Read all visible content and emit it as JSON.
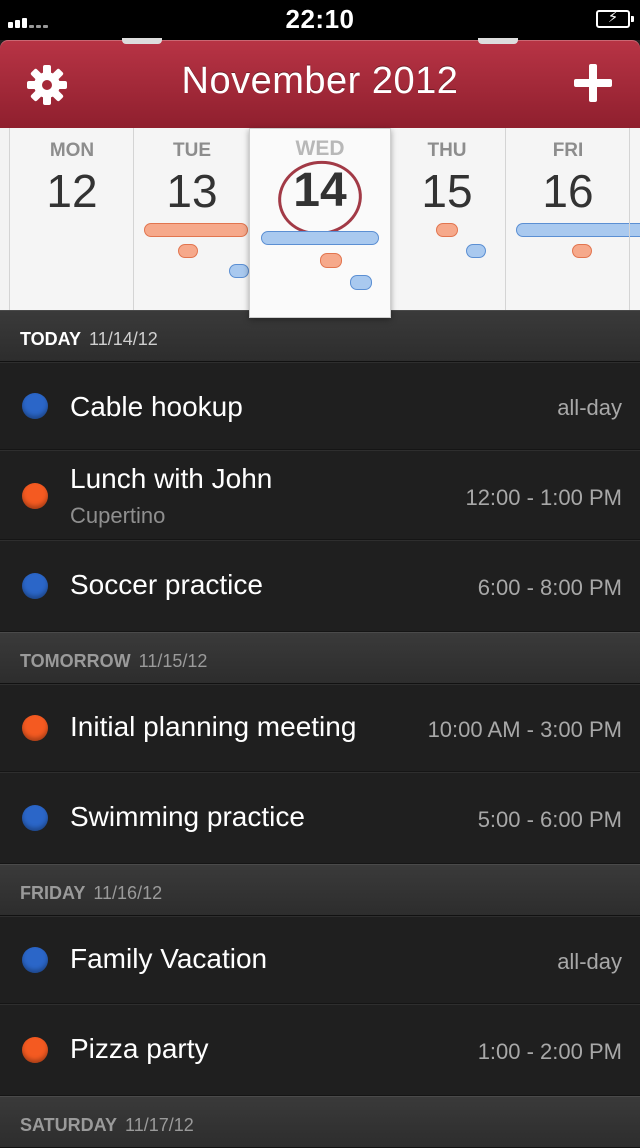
{
  "status": {
    "time": "22:10"
  },
  "header": {
    "title": "November 2012"
  },
  "colors": {
    "orange": "#f45a21",
    "blue": "#2b66c8",
    "header": "#a52838"
  },
  "week": [
    {
      "name": "",
      "num": ""
    },
    {
      "name": "MON",
      "num": "12"
    },
    {
      "name": "TUE",
      "num": "13"
    },
    {
      "name": "WED",
      "num": "14"
    },
    {
      "name": "THU",
      "num": "15"
    },
    {
      "name": "FRI",
      "num": "16"
    }
  ],
  "sections": [
    {
      "label": "TODAY",
      "date": "11/14/12"
    },
    {
      "label": "TOMORROW",
      "date": "11/15/12"
    },
    {
      "label": "FRIDAY",
      "date": "11/16/12"
    },
    {
      "label": "SATURDAY",
      "date": "11/17/12"
    }
  ],
  "events": [
    {
      "title": "Cable hookup",
      "sub": "",
      "time": "all-day",
      "color": "blue"
    },
    {
      "title": "Lunch with John",
      "sub": "Cupertino",
      "time": "12:00 - 1:00 PM",
      "color": "orange"
    },
    {
      "title": "Soccer practice",
      "sub": "",
      "time": "6:00 - 8:00 PM",
      "color": "blue"
    },
    {
      "title": "Initial planning meeting",
      "sub": "",
      "time": "10:00 AM - 3:00 PM",
      "color": "orange"
    },
    {
      "title": "Swimming practice",
      "sub": "",
      "time": "5:00 - 6:00 PM",
      "color": "blue"
    },
    {
      "title": "Family Vacation",
      "sub": "",
      "time": "all-day",
      "color": "blue"
    },
    {
      "title": "Pizza party",
      "sub": "",
      "time": "1:00 - 2:00 PM",
      "color": "orange"
    }
  ]
}
